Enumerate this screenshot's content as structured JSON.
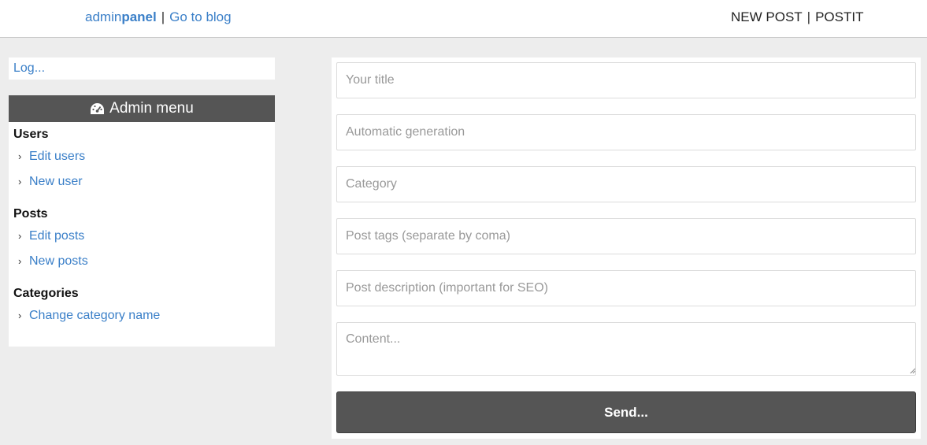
{
  "header": {
    "brand_light": "admin",
    "brand_bold": "panel",
    "separator": "|",
    "blog_link": "Go to blog",
    "new_post": "NEW POST",
    "site_name": "POSTIT"
  },
  "sidebar": {
    "log_text": "Log...",
    "menu_title": "Admin menu",
    "menu_icon": "dashboard-icon",
    "sections": [
      {
        "title": "Users",
        "items": [
          "Edit users",
          "New user"
        ]
      },
      {
        "title": "Posts",
        "items": [
          "Edit posts",
          "New posts"
        ]
      },
      {
        "title": "Categories",
        "items": [
          "Change category name"
        ]
      }
    ]
  },
  "form": {
    "title_placeholder": "Your title",
    "slug_placeholder": "Automatic generation",
    "category_placeholder": "Category",
    "tags_placeholder": "Post tags (separate by coma)",
    "description_placeholder": "Post description (important for SEO)",
    "content_placeholder": "Content...",
    "submit_label": "Send..."
  },
  "colors": {
    "accent": "#3a7fc8",
    "dark": "#555555",
    "background": "#ededed"
  }
}
